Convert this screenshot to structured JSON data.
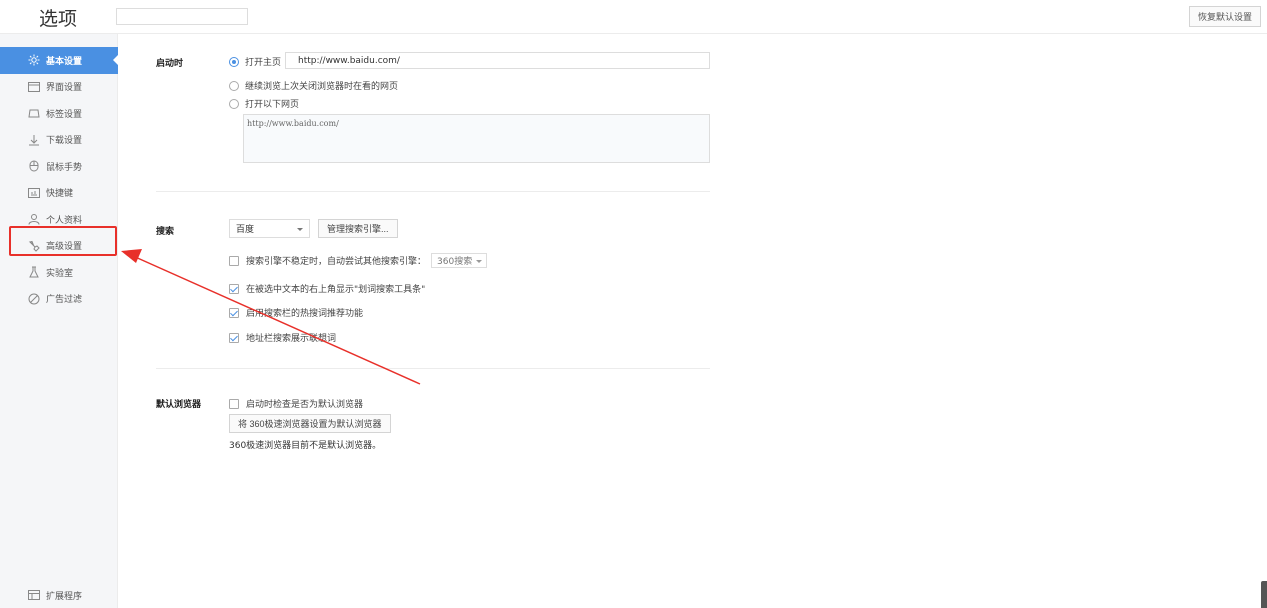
{
  "header": {
    "title": "选项",
    "search_placeholder": "",
    "restore_label": "恢复默认设置"
  },
  "sidebar": {
    "items": [
      {
        "label": "基本设置",
        "icon": "gear-icon",
        "active": true
      },
      {
        "label": "界面设置",
        "icon": "window-icon"
      },
      {
        "label": "标签设置",
        "icon": "tab-icon"
      },
      {
        "label": "下载设置",
        "icon": "download-icon"
      },
      {
        "label": "鼠标手势",
        "icon": "mouse-icon"
      },
      {
        "label": "快捷键",
        "icon": "keyboard-icon"
      },
      {
        "label": "个人资料",
        "icon": "user-icon"
      },
      {
        "label": "高级设置",
        "icon": "wrench-icon"
      },
      {
        "label": "实验室",
        "icon": "flask-icon"
      },
      {
        "label": "广告过滤",
        "icon": "block-icon"
      }
    ],
    "bottom": {
      "label": "扩展程序",
      "icon": "extension-icon"
    }
  },
  "startup": {
    "label": "启动时",
    "option_homepage": "打开主页",
    "homepage_url": "http://www.baidu.com/",
    "option_continue": "继续浏览上次关闭浏览器时在看的网页",
    "option_pages": "打开以下网页",
    "pages_value": "http://www.baidu.com/"
  },
  "search": {
    "label": "搜索",
    "engine_selected": "百度",
    "manage_label": "管理搜索引擎...",
    "fallback_text": "搜索引擎不稳定时，自动尝试其他搜索引擎：",
    "fallback_engine": "360搜索",
    "option_toolbar": "在被选中文本的右上角显示\"划词搜索工具条\"",
    "option_hot": "启用搜索栏的热搜词推荐功能",
    "option_address": "地址栏搜索展示联想词"
  },
  "default_browser": {
    "label": "默认浏览器",
    "check_label": "启动时检查是否为默认浏览器",
    "set_button": "将 360极速浏览器设置为默认浏览器",
    "status": "360极速浏览器目前不是默认浏览器。"
  },
  "colors": {
    "accent": "#4a90e2",
    "highlight": "#e8302a"
  }
}
